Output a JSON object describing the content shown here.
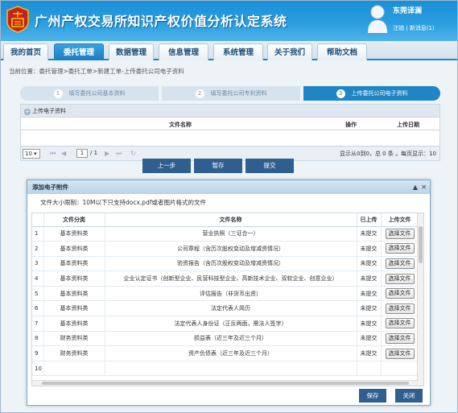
{
  "header": {
    "title": "广州产权交易所知识产权价值分析认定系统",
    "username": "东莞译澜",
    "logout": "注销",
    "messages": "新消息(1)"
  },
  "nav": [
    "我的首页",
    "委托管理",
    "数据管理",
    "信息管理",
    "系统管理",
    "关于我们",
    "帮助文档"
  ],
  "breadcrumb": "当前位置：委托管理>委托工单>新建工单-上传委托公司电子资料",
  "steps": [
    {
      "num": "1",
      "label": "填写委托公司基本资料"
    },
    {
      "num": "2",
      "label": "填写委托公司专利资料"
    },
    {
      "num": "3",
      "label": "上传委托公司电子资料"
    }
  ],
  "upload": {
    "header": "上传电子资料",
    "col_filename": "文件名称",
    "col_action": "操作",
    "col_date": "上传日期",
    "page_size": "10",
    "page": "1",
    "page_total": "/ 1",
    "info": "显示从0到0，总 0 条 。每页显示：10"
  },
  "actions": {
    "prev": "上一步",
    "save": "暂存",
    "submit": "提交"
  },
  "dialog": {
    "title": "添加电子附件",
    "notice": "文件大小限制：10M以下只支持docx,pdf或者图片格式的文件",
    "columns": [
      "",
      "文件分类",
      "文件名称",
      "已上传",
      "上传文件"
    ],
    "rows": [
      [
        "1",
        "基本资料类",
        "营业执照（三证合一）",
        "未提交",
        "选择文件"
      ],
      [
        "2",
        "基本资料类",
        "公司章程（含历次股权变动及增减资情况）",
        "未提交",
        "选择文件"
      ],
      [
        "3",
        "基本资料类",
        "验资报告（含历次股权变动及增减资情况）",
        "未提交",
        "选择文件"
      ],
      [
        "4",
        "基本资料类",
        "企业认定证书（创新型企业、民营科技型企业、高新技术企业、双软企业、创意企业）",
        "未提交",
        "选择文件"
      ],
      [
        "5",
        "基本资料类",
        "评估报告（非货币出资）",
        "未提交",
        "选择文件"
      ],
      [
        "6",
        "基本资料类",
        "法定代表人简历",
        "未提交",
        "选择文件"
      ],
      [
        "7",
        "基本资料类",
        "法定代表人身份证（正反两面，需法人签字）",
        "未提交",
        "选择文件"
      ],
      [
        "8",
        "财务资料类",
        "损益表（近三年及近三个月）",
        "未提交",
        "选择文件"
      ],
      [
        "9",
        "财务资料类",
        "资产负债表（近三年及近三个月）",
        "未提交",
        "选择文件"
      ],
      [
        "10",
        "",
        "",
        "",
        ""
      ]
    ],
    "save": "保存",
    "close": "关闭"
  }
}
